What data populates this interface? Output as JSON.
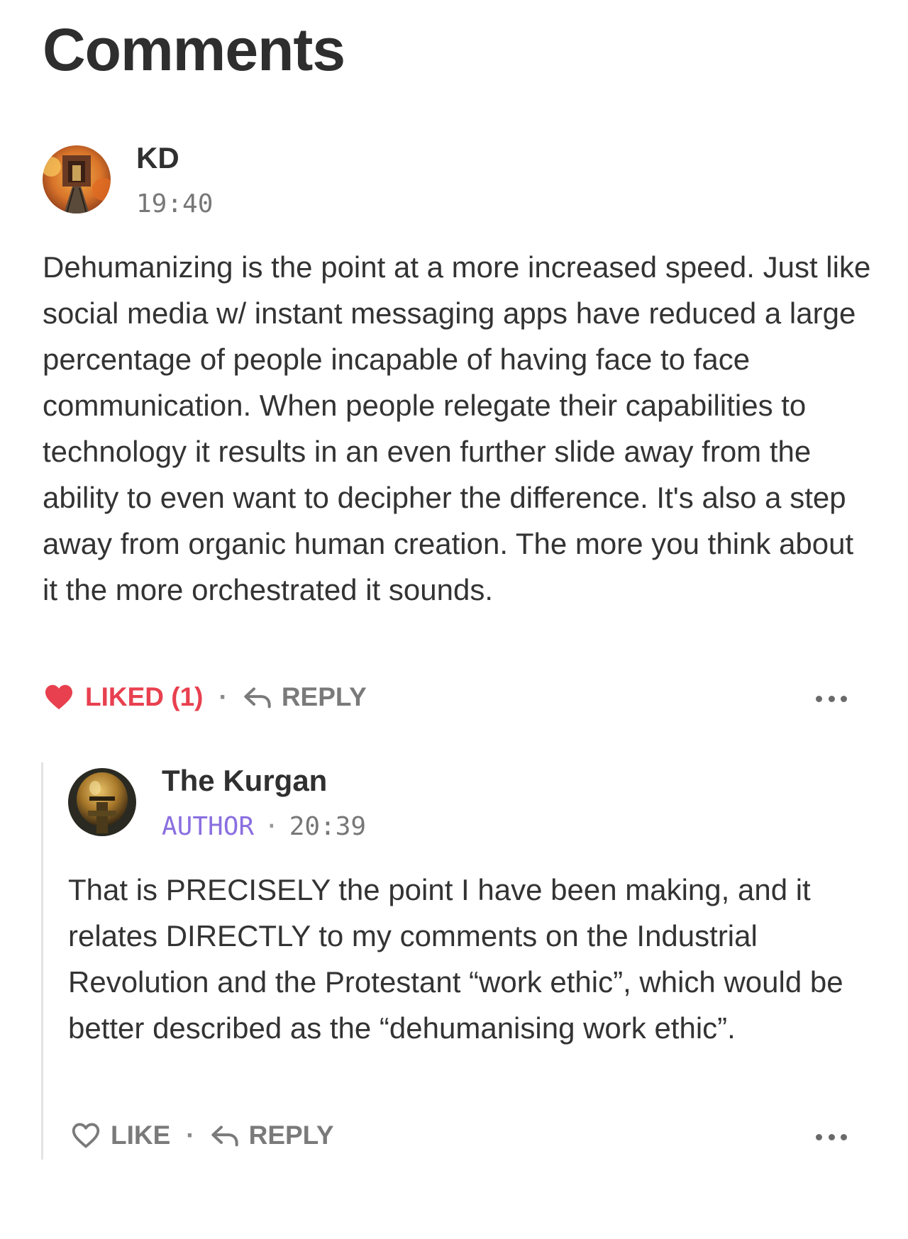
{
  "heading": "Comments",
  "comments": [
    {
      "author": "KD",
      "time": "19:40",
      "text": "Dehumanizing is the point at a more increased speed. Just like social media w/ instant messaging apps have reduced a large percentage of people incapable of having face to face communication. When people relegate their capabilities to technology it results in an even further slide away from the ability to even want to decipher the difference. It's also a step away from organic human creation. The more you think about it the more orchestrated it sounds.",
      "like_label": "LIKED (1)",
      "reply_label": "REPLY",
      "separator": "·"
    },
    {
      "author": "The Kurgan",
      "badge": "AUTHOR",
      "separator": "·",
      "time": "20:39",
      "text": "That is PRECISELY the point I have been making, and it relates DIRECTLY to my comments on the Industrial Revolution and the Protestant “work ethic”, which would be better described as the “dehumanising work ethic”.",
      "like_label": "LIKE",
      "reply_label": "REPLY"
    }
  ],
  "icons": {
    "liked": "heart-filled-icon",
    "like": "heart-outline-icon",
    "reply": "reply-arrow-icon",
    "more": "more-horizontal-icon"
  },
  "colors": {
    "liked": "#e8404f",
    "author_badge": "#8a6fe0",
    "muted": "#7a7a7a"
  }
}
